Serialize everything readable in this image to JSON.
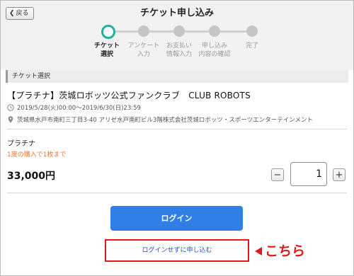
{
  "header": {
    "back_label": "戻る",
    "title": "チケット申し込み"
  },
  "steps": [
    {
      "label": "チケット\n選択",
      "active": true
    },
    {
      "label": "アンケート\n入力",
      "active": false
    },
    {
      "label": "お支払い\n情報入力",
      "active": false
    },
    {
      "label": "申し込み\n内容の確認",
      "active": false
    },
    {
      "label": "完了",
      "active": false
    }
  ],
  "section": {
    "title": "チケット選択"
  },
  "event": {
    "title": "【プラチナ】茨城ロボッツ公式ファンクラブ　CLUB ROBOTS",
    "period": "2019/5/28(火)00:00～2019/6/30(日)23:59",
    "venue": "茨城県水戸市南町三丁目3-40 アリゼ水戸南町ビル3階株式会社茨城ロボッツ・スポーツエンターテインメント"
  },
  "plan": {
    "name": "プラチナ",
    "limit_note": "1度の購入で1枚まで",
    "price": "33,000円",
    "quantity": "1",
    "minus": "−",
    "plus": "+"
  },
  "actions": {
    "login_label": "ログイン",
    "no_login_label": "ログインせずに申し込む",
    "annotation": "こちら"
  },
  "colors": {
    "accent_green": "#1fb39b",
    "login_blue": "#2f7fe6",
    "highlight_red": "#e0191c",
    "note_orange": "#e07a3a"
  }
}
